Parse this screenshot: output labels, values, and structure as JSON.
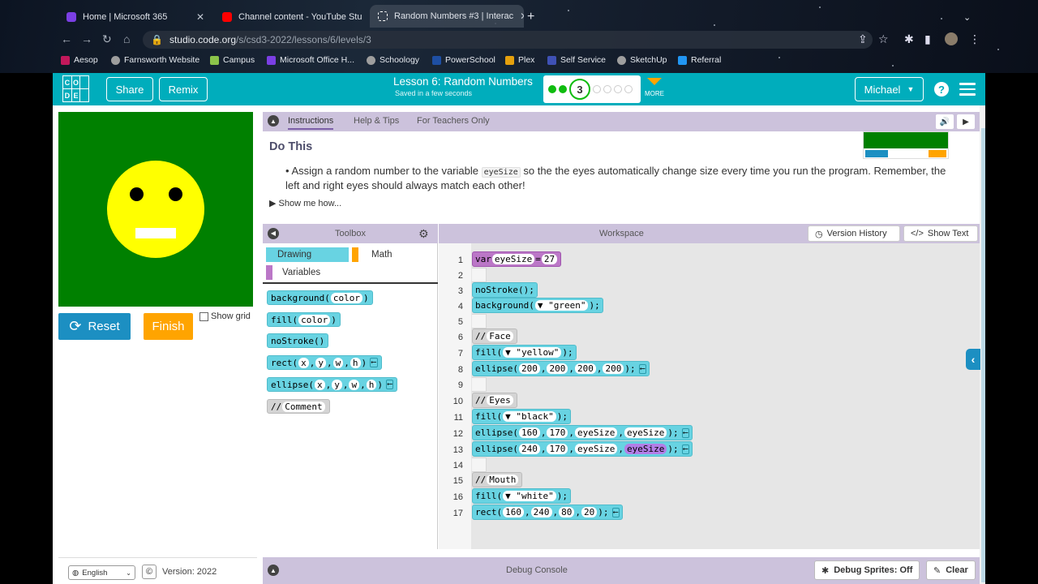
{
  "browser": {
    "tabs": [
      {
        "label": "Home | Microsoft 365",
        "color": "#7b3fe4"
      },
      {
        "label": "Channel content - YouTube Stu",
        "color": "#ff0000"
      },
      {
        "label": "Random Numbers #3 | Interac",
        "color": "#ffffff"
      }
    ],
    "url_host": "studio.code.org",
    "url_path": "/s/csd3-2022/lessons/6/levels/3",
    "bookmarks": [
      {
        "label": "Aesop",
        "color": "#c2185b"
      },
      {
        "label": "Farnsworth Website",
        "color": "#9e9e9e"
      },
      {
        "label": "Campus",
        "color": "#8bc34a"
      },
      {
        "label": "Microsoft Office H...",
        "color": "#7b3fe4"
      },
      {
        "label": "Schoology",
        "color": "#9e9e9e"
      },
      {
        "label": "PowerSchool",
        "color": "#1e4fa3"
      },
      {
        "label": "Plex",
        "color": "#e5a00d"
      },
      {
        "label": "Self Service",
        "color": "#3f51b5"
      },
      {
        "label": "SketchUp",
        "color": "#9e9e9e"
      },
      {
        "label": "Referral",
        "color": "#2196f3"
      }
    ]
  },
  "header": {
    "logo_letters": [
      "C",
      "O",
      "",
      "D",
      "E",
      ""
    ],
    "share": "Share",
    "remix": "Remix",
    "lesson_title": "Lesson 6: Random Numbers",
    "saved": "Saved in a few seconds",
    "current_level": "3",
    "more": "MORE",
    "user": "Michael",
    "help": "?"
  },
  "stage": {
    "reset": "Reset",
    "finish": "Finish",
    "show_grid": "Show grid"
  },
  "instructions": {
    "tabs": [
      "Instructions",
      "Help & Tips",
      "For Teachers Only"
    ],
    "heading": "Do This",
    "text_before": "Assign a random number to the variable",
    "code": "eyeSize",
    "text_after": "so the the eyes automatically change size every time you run the program. Remember, the left and right eyes should always match each other!",
    "show_me": "Show me how..."
  },
  "toolbox": {
    "title": "Toolbox",
    "categories": [
      "Drawing",
      "Math",
      "Variables"
    ],
    "blocks": [
      {
        "name": "background",
        "params": [
          "color"
        ],
        "end": false
      },
      {
        "name": "fill",
        "params": [
          "color"
        ],
        "end": false
      },
      {
        "name": "noStroke()",
        "params": [],
        "end": false
      },
      {
        "name": "rect",
        "params": [
          "x",
          "y",
          "w",
          "h"
        ],
        "end": true
      },
      {
        "name": "ellipse",
        "params": [
          "x",
          "y",
          "w",
          "h"
        ],
        "end": true
      },
      {
        "name": "//",
        "params": [
          "Comment"
        ],
        "end": false
      }
    ]
  },
  "workspace": {
    "title": "Workspace",
    "version_history": "Version History",
    "show_text": "Show Text",
    "lines": [
      {
        "n": "1",
        "text": "var eyeSize = 27"
      },
      {
        "n": "2",
        "text": ""
      },
      {
        "n": "3",
        "text": "noStroke();"
      },
      {
        "n": "4",
        "text": "background(\"green\");"
      },
      {
        "n": "5",
        "text": ""
      },
      {
        "n": "6",
        "text": "// Face"
      },
      {
        "n": "7",
        "text": "fill(\"yellow\");"
      },
      {
        "n": "8",
        "text": "ellipse(200,200,200,200);"
      },
      {
        "n": "9",
        "text": ""
      },
      {
        "n": "10",
        "text": "// Eyes"
      },
      {
        "n": "11",
        "text": "fill(\"black\");"
      },
      {
        "n": "12",
        "text": "ellipse(160,170,eyeSize,eyeSize);"
      },
      {
        "n": "13",
        "text": "ellipse(240,170,eyeSize,eyeSize);"
      },
      {
        "n": "14",
        "text": ""
      },
      {
        "n": "15",
        "text": "// Mouth"
      },
      {
        "n": "16",
        "text": "fill(\"white\");"
      },
      {
        "n": "17",
        "text": "rect(160,240,80,20);"
      }
    ]
  },
  "footer": {
    "language": "English",
    "copyright": "©",
    "version": "Version: 2022"
  },
  "debug": {
    "title": "Debug Console",
    "sprites": "Debug Sprites: Off",
    "clear": "Clear"
  },
  "colors": {
    "accent": "#00adbc",
    "panel": "#ccc2dc",
    "block": "#68d3e2",
    "var_block": "#bb77c7",
    "reset": "#1c8fc2",
    "finish": "#ffa400"
  }
}
